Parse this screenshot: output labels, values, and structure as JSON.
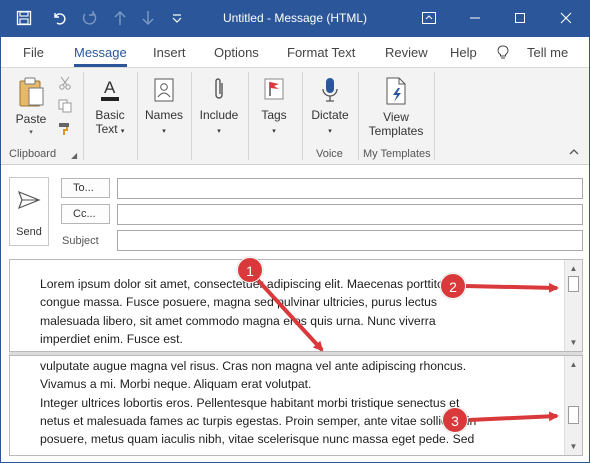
{
  "window": {
    "title": "Untitled - Message (HTML)",
    "accent_color": "#2b579a"
  },
  "quick_access": {
    "icons": [
      "save-icon",
      "undo-icon",
      "redo-icon",
      "up-arrow-icon",
      "down-arrow-icon",
      "customize-dropdown-icon"
    ]
  },
  "window_controls": {
    "icons": [
      "ribbon-display-icon",
      "minimize-icon",
      "maximize-icon",
      "close-icon"
    ]
  },
  "tabs": [
    {
      "label": "File"
    },
    {
      "label": "Message",
      "active": true
    },
    {
      "label": "Insert"
    },
    {
      "label": "Options"
    },
    {
      "label": "Format Text"
    },
    {
      "label": "Review"
    },
    {
      "label": "Help"
    },
    {
      "label": "Tell me"
    }
  ],
  "ribbon": {
    "paste": "Paste",
    "basic_text": [
      "Basic",
      "Text"
    ],
    "names": "Names",
    "include": "Include",
    "tags": "Tags",
    "dictate": "Dictate",
    "view_templates": [
      "View",
      "Templates"
    ],
    "groups": {
      "clipboard": "Clipboard",
      "voice": "Voice",
      "my_templates": "My Templates"
    }
  },
  "compose": {
    "send": "Send",
    "to_button": "To...",
    "cc_button": "Cc...",
    "subject_label": "Subject",
    "to_value": "",
    "cc_value": "",
    "subject_value": ""
  },
  "body": {
    "top_pane_lines": [
      "Lorem ipsum dolor sit amet, consectetuer adipiscing elit. Maecenas porttitor",
      "congue massa. Fusce posuere, magna sed pulvinar ultricies, purus lectus",
      "malesuada libero, sit amet commodo magna eros quis urna. Nunc viverra",
      "imperdiet enim. Fusce est."
    ],
    "bottom_pane_lines": [
      "vulputate augue magna vel risus. Cras non magna vel ante adipiscing rhoncus.",
      "Vivamus a mi. Morbi neque. Aliquam erat volutpat.",
      "Integer ultrices lobortis eros. Pellentesque habitant morbi tristique senectus et",
      "netus et malesuada fames ac turpis egestas. Proin semper, ante vitae sollicitudin",
      "posuere, metus quam iaculis nibh, vitae scelerisque nunc massa eget pede. Sed"
    ]
  },
  "annotations": {
    "badges": [
      "1",
      "2",
      "3"
    ],
    "color": "#d9393a"
  }
}
